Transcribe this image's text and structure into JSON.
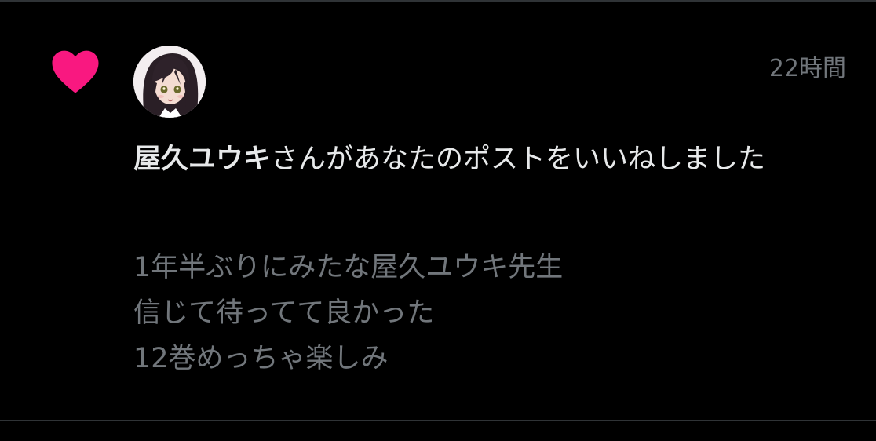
{
  "notification": {
    "timestamp": "22時間",
    "user_name": "屋久ユウキ",
    "action_text": "さんがあなたのポストをいいねしました",
    "post_lines": [
      "1年半ぶりにみたな屋久ユウキ先生",
      "信じて待ってて良かった",
      "12巻めっちゃ楽しみ"
    ]
  },
  "icons": {
    "like": "heart-icon"
  },
  "colors": {
    "background": "#000000",
    "heart": "#f91880",
    "primary_text": "#e7e9ea",
    "secondary_text": "#71767b",
    "divider": "#2f3336"
  }
}
